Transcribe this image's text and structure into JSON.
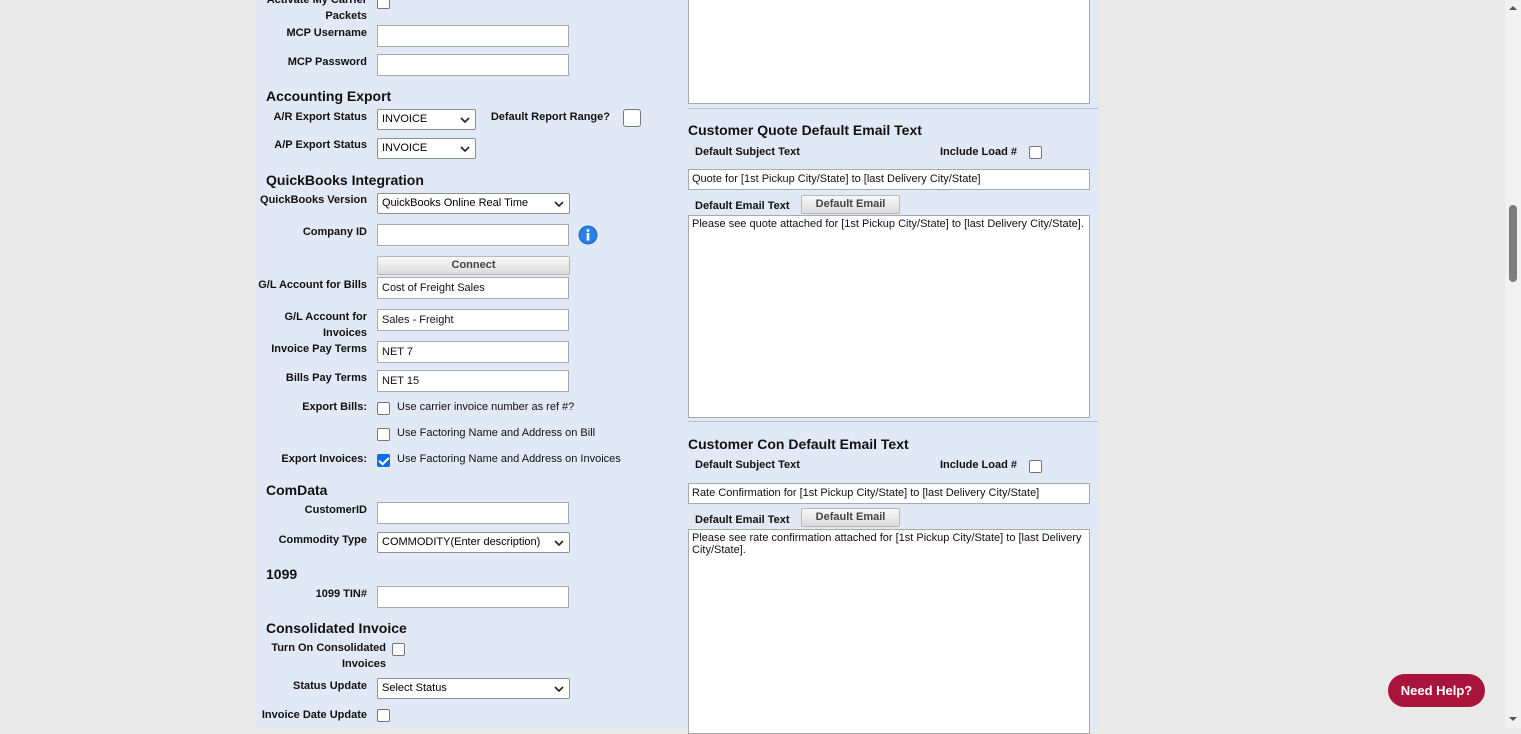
{
  "left": {
    "activate_label": "Activate My Carrier Packets",
    "mcp_username_label": "MCP Username",
    "mcp_password_label": "MCP Password",
    "accounting_title": "Accounting Export",
    "ar_label": "A/R Export Status",
    "ar_value": "INVOICE",
    "default_range_label": "Default Report Range?",
    "ap_label": "A/P Export Status",
    "ap_value": "INVOICE",
    "qb_title": "QuickBooks Integration",
    "qb_version_label": "QuickBooks Version",
    "qb_version_value": "QuickBooks Online Real Time",
    "company_id_label": "Company ID",
    "connect_label": "Connect",
    "gl_bills_label": "G/L Account for Bills",
    "gl_bills_value": "Cost of Freight Sales",
    "gl_invoices_label": "G/L Account for Invoices",
    "gl_invoices_value": "Sales - Freight",
    "invoice_terms_label": "Invoice Pay Terms",
    "invoice_terms_value": "NET 7",
    "bills_terms_label": "Bills Pay Terms",
    "bills_terms_value": "NET 15",
    "export_bills_label": "Export Bills:",
    "export_bills_opt1": "Use carrier invoice number as ref #?",
    "export_bills_opt2": "Use Factoring Name and Address on Bill",
    "export_invoices_label": "Export Invoices:",
    "export_invoices_opt": "Use Factoring Name and Address on Invoices",
    "comdata_title": "ComData",
    "customer_id_label": "CustomerID",
    "commodity_label": "Commodity Type",
    "commodity_value": "COMMODITY(Enter description)",
    "t1099_title": "1099",
    "tin_label": "1099 TIN#",
    "consolidated_title": "Consolidated Invoice",
    "turn_on_label": "Turn On Consolidated Invoices",
    "status_update_label": "Status Update",
    "status_update_value": "Select Status",
    "invoice_date_label": "Invoice Date Update"
  },
  "right": {
    "quote_title": "Customer Quote Default Email Text",
    "quote_subject_label": "Default Subject Text",
    "quote_include_label": "Include Load #",
    "quote_subject_value": "Quote for [1st Pickup City/State] to [last Delivery City/State]",
    "quote_email_label": "Default Email Text",
    "quote_default_btn": "Default Email",
    "quote_body": "Please see quote attached for [1st Pickup City/State] to [last Delivery City/State].",
    "con_title": "Customer Con Default Email Text",
    "con_subject_label": "Default Subject Text",
    "con_include_label": "Include Load #",
    "con_subject_value": "Rate Confirmation for [1st Pickup City/State] to [last Delivery City/State]",
    "con_email_label": "Default Email Text",
    "con_default_btn": "Default Email",
    "con_body": "Please see rate confirmation attached for [1st Pickup City/State] to [last Delivery City/State]."
  },
  "help_label": "Need Help?",
  "icons": {
    "info": "info-icon",
    "chevron": "chevron-down-icon"
  },
  "colors": {
    "panel": "#e2e9f6",
    "help": "#a8143b",
    "checkbox_checked": "#0b6ee0"
  }
}
